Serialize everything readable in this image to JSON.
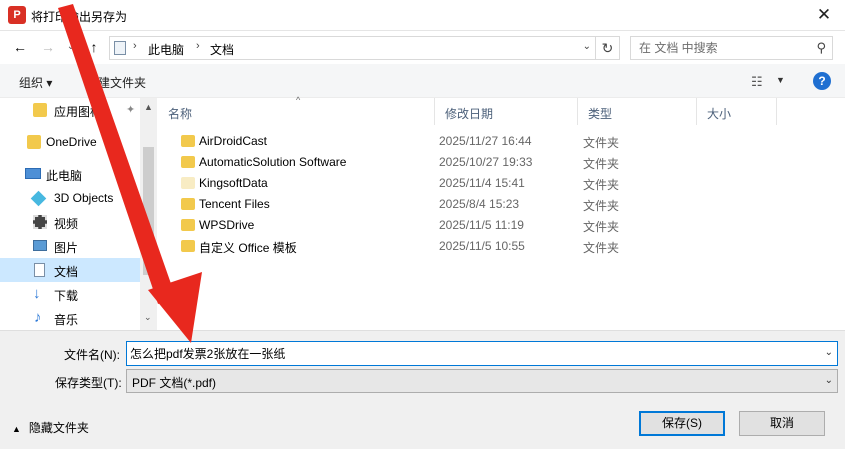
{
  "titlebar": {
    "app_icon_text": "P",
    "title": "将打印输出另存为",
    "close_glyph": "✕"
  },
  "nav": {
    "back_glyph": "←",
    "forward_glyph": "→",
    "recent_glyph": "⌄",
    "up_glyph": "↑",
    "breadcrumb": [
      "此电脑",
      "文档"
    ],
    "breadcrumb_sep": "›",
    "dropdown_glyph": "⌄",
    "refresh_glyph": "↻",
    "search_placeholder": "在 文档 中搜索",
    "search_glyph": "⚲"
  },
  "toolbar": {
    "organize_label": "组织 ▾",
    "new_folder_label": "新建文件夹",
    "view_glyph": "☷",
    "view_dropdown": "▼",
    "help_glyph": "?"
  },
  "sidebar": {
    "pin_glyph": "✦",
    "items": [
      {
        "label": "应用图标",
        "icon": "folder-icon"
      },
      {
        "label": "OneDrive",
        "icon": "folder-icon"
      },
      {
        "label": "此电脑",
        "icon": "computer-icon"
      },
      {
        "label": "3D Objects",
        "icon": "cube-icon"
      },
      {
        "label": "视频",
        "icon": "video-icon"
      },
      {
        "label": "图片",
        "icon": "picture-icon"
      },
      {
        "label": "文档",
        "icon": "document-icon"
      },
      {
        "label": "下载",
        "icon": "download-icon"
      },
      {
        "label": "音乐",
        "icon": "music-icon"
      }
    ],
    "scroll_up": "▲",
    "scroll_down": "⌄"
  },
  "filelist": {
    "sort_indicator": "^",
    "columns": [
      "名称",
      "修改日期",
      "类型",
      "大小"
    ],
    "rows": [
      {
        "name": "AirDroidCast",
        "date": "2025/11/27 16:44",
        "type": "文件夹"
      },
      {
        "name": "AutomaticSolution Software",
        "date": "2025/10/27 19:33",
        "type": "文件夹"
      },
      {
        "name": "KingsoftData",
        "date": "2025/11/4 15:41",
        "type": "文件夹"
      },
      {
        "name": "Tencent Files",
        "date": "2025/8/4 15:23",
        "type": "文件夹"
      },
      {
        "name": "WPSDrive",
        "date": "2025/11/5 11:19",
        "type": "文件夹"
      },
      {
        "name": "自定义 Office 模板",
        "date": "2025/11/5 10:55",
        "type": "文件夹"
      }
    ]
  },
  "form": {
    "filename_label": "文件名(N):",
    "filename_value": "怎么把pdf发票2张放在一张纸",
    "filetype_label": "保存类型(T):",
    "filetype_value": "PDF 文档(*.pdf)",
    "dropdown_glyph": "⌄",
    "hide_folders_chevron": "▲",
    "hide_folders_label": "隐藏文件夹",
    "save_label": "保存(S)",
    "cancel_label": "取消"
  },
  "colors": {
    "accent": "#0078d7",
    "selection": "#cce8ff",
    "folder": "#f2c94c",
    "annotation_arrow": "#e8281e"
  }
}
